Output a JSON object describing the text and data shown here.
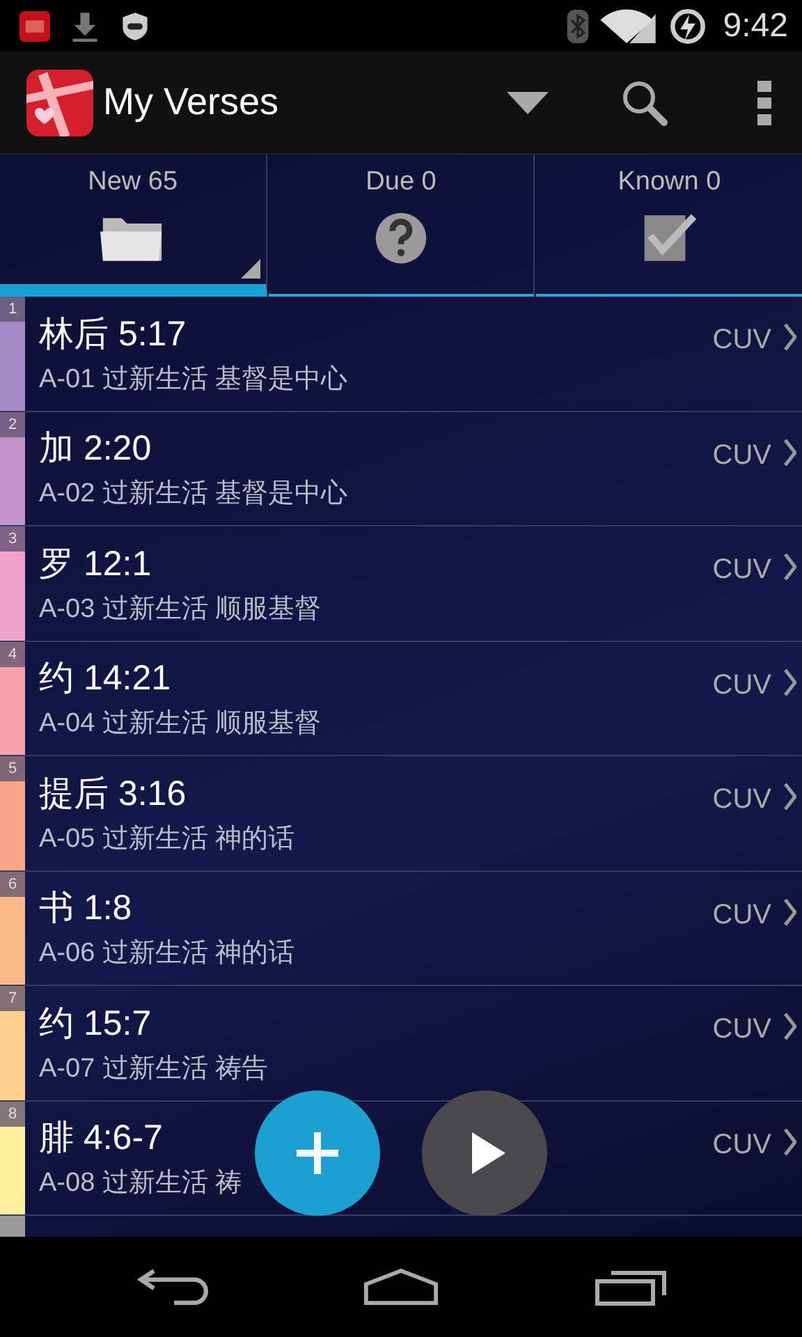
{
  "status_bar": {
    "time": "9:42"
  },
  "action_bar": {
    "title": "My Verses"
  },
  "tabs": [
    {
      "label": "New 65",
      "kind": "folder",
      "selected": true
    },
    {
      "label": "Due 0",
      "kind": "question",
      "selected": false
    },
    {
      "label": "Known 0",
      "kind": "check",
      "selected": false
    }
  ],
  "verses": [
    {
      "number": "1",
      "reference": "林后 5:17",
      "topic": "A-01 过新生活 基督是中心",
      "version": "CUV",
      "color": "#a28bc6"
    },
    {
      "number": "2",
      "reference": "加 2:20",
      "topic": "A-02 过新生活 基督是中心",
      "version": "CUV",
      "color": "#c494cc"
    },
    {
      "number": "3",
      "reference": "罗 12:1",
      "topic": "A-03 过新生活 顺服基督",
      "version": "CUV",
      "color": "#f0a2cc"
    },
    {
      "number": "4",
      "reference": "约 14:21",
      "topic": "A-04 过新生活 顺服基督",
      "version": "CUV",
      "color": "#f6a2ac"
    },
    {
      "number": "5",
      "reference": "提后 3:16",
      "topic": "A-05 过新生活 神的话",
      "version": "CUV",
      "color": "#f7a68c"
    },
    {
      "number": "6",
      "reference": "书 1:8",
      "topic": "A-06 过新生活 神的话",
      "version": "CUV",
      "color": "#f9ba8a"
    },
    {
      "number": "7",
      "reference": "约 15:7",
      "topic": "A-07 过新生活 祷告",
      "version": "CUV",
      "color": "#fcd08e"
    },
    {
      "number": "8",
      "reference": "腓 4:6-7",
      "topic": "A-08 过新生活 祷",
      "version": "CUV",
      "color": "#fdf09c"
    }
  ]
}
